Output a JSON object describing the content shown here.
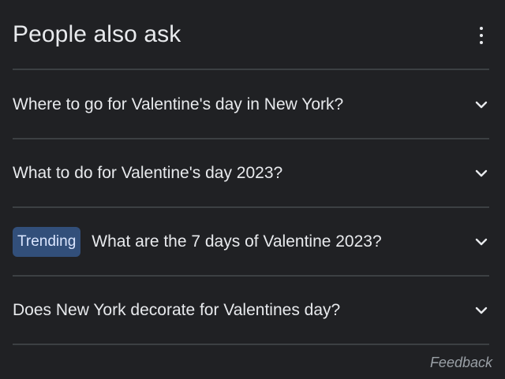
{
  "section": {
    "title": "People also ask"
  },
  "questions": [
    {
      "text": "Where to go for Valentine's day in New York?"
    },
    {
      "text": "What to do for Valentine's day 2023?"
    },
    {
      "badge": "Trending",
      "text": "What are the 7 days of Valentine 2023?"
    },
    {
      "text": "Does New York decorate for Valentines day?"
    }
  ],
  "footer": {
    "feedback_label": "Feedback"
  },
  "icons": {
    "more": "more-vert-icon",
    "expand": "chevron-down-icon"
  },
  "colors": {
    "background": "#202124",
    "text": "#e8eaed",
    "divider": "#3c4043",
    "badge_bg": "#324f7a",
    "feedback": "#9aa0a6"
  }
}
